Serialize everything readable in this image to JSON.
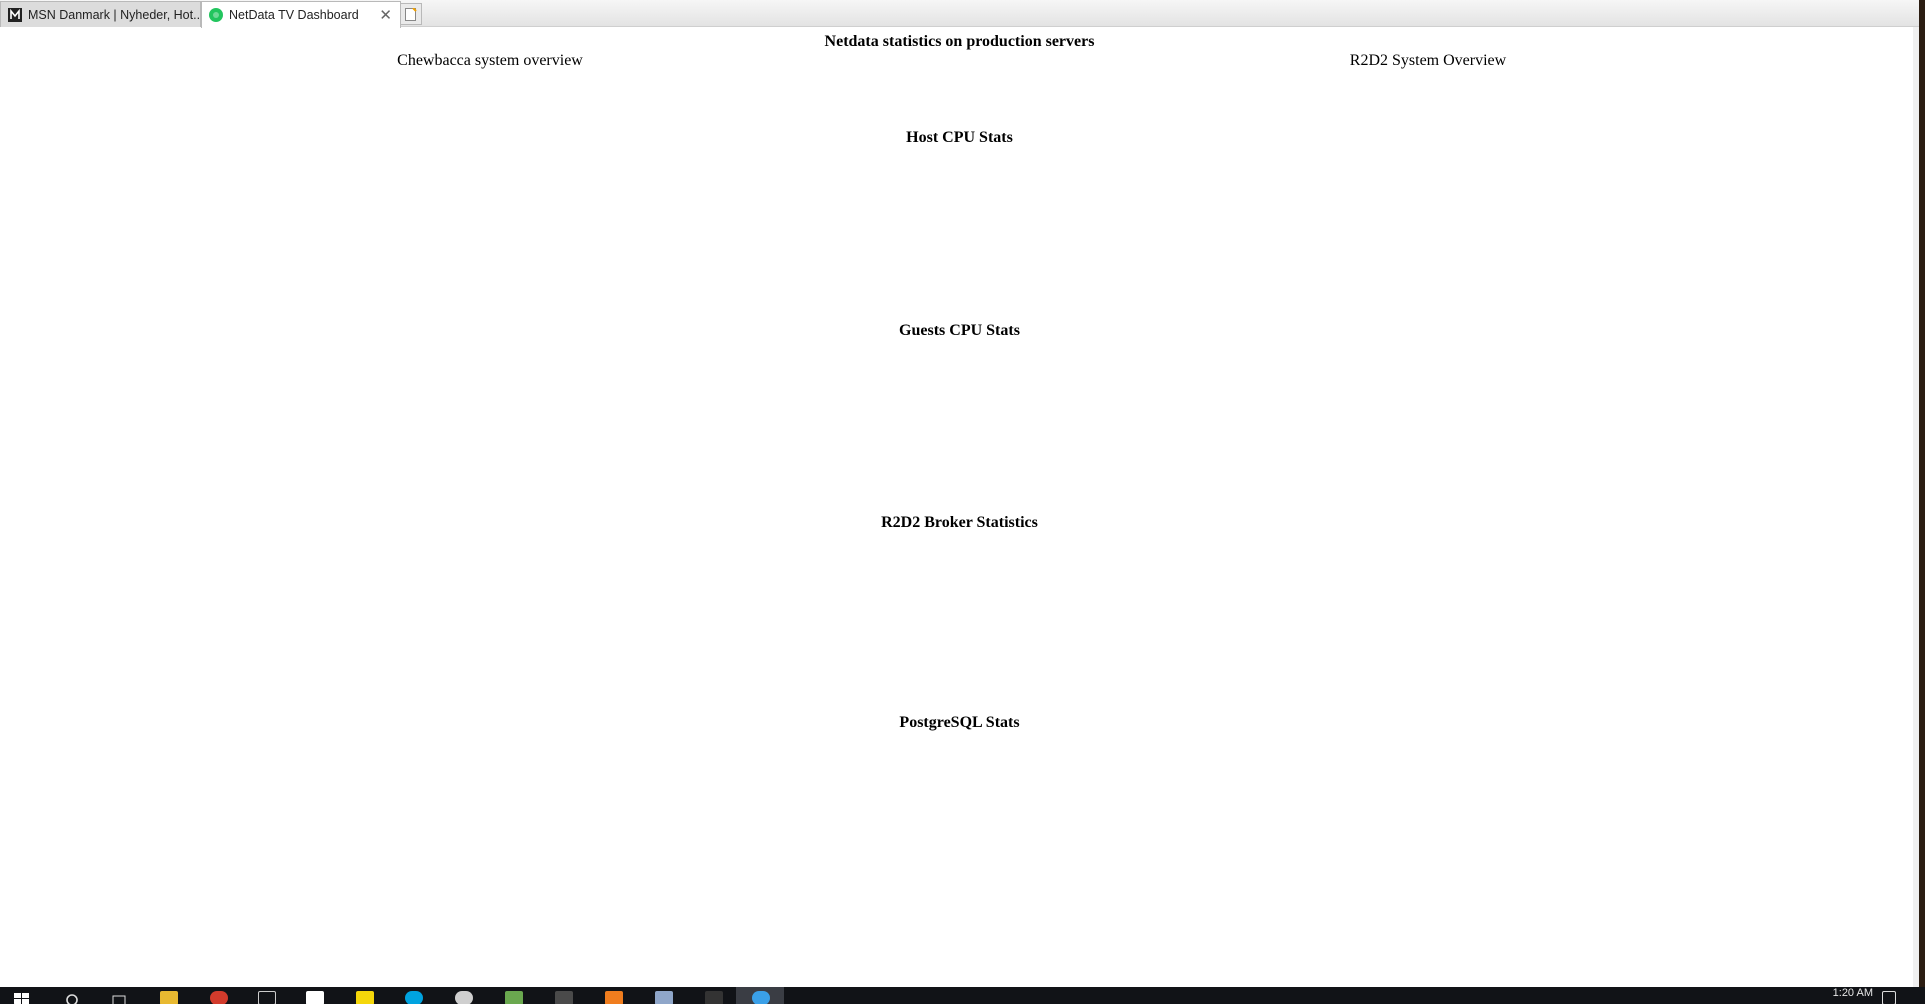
{
  "tabs": [
    {
      "title": "MSN Danmark | Nyheder, Hot...",
      "active": false,
      "icon": "msn-icon"
    },
    {
      "title": "NetData TV Dashboard",
      "active": true,
      "icon": "netdata-icon"
    }
  ],
  "page": {
    "title": "Netdata statistics on production servers",
    "overview_left": "Chewbacca system overview",
    "overview_right": "R2D2 System Overview",
    "sections": [
      "Host CPU Stats",
      "Guests CPU Stats",
      "R2D2 Broker Statistics",
      "PostgreSQL Stats"
    ]
  },
  "taskbar": {
    "clock": "1:20 AM"
  },
  "colors": {
    "netdata_green": "#22c55e",
    "taskbar": "#111317"
  }
}
